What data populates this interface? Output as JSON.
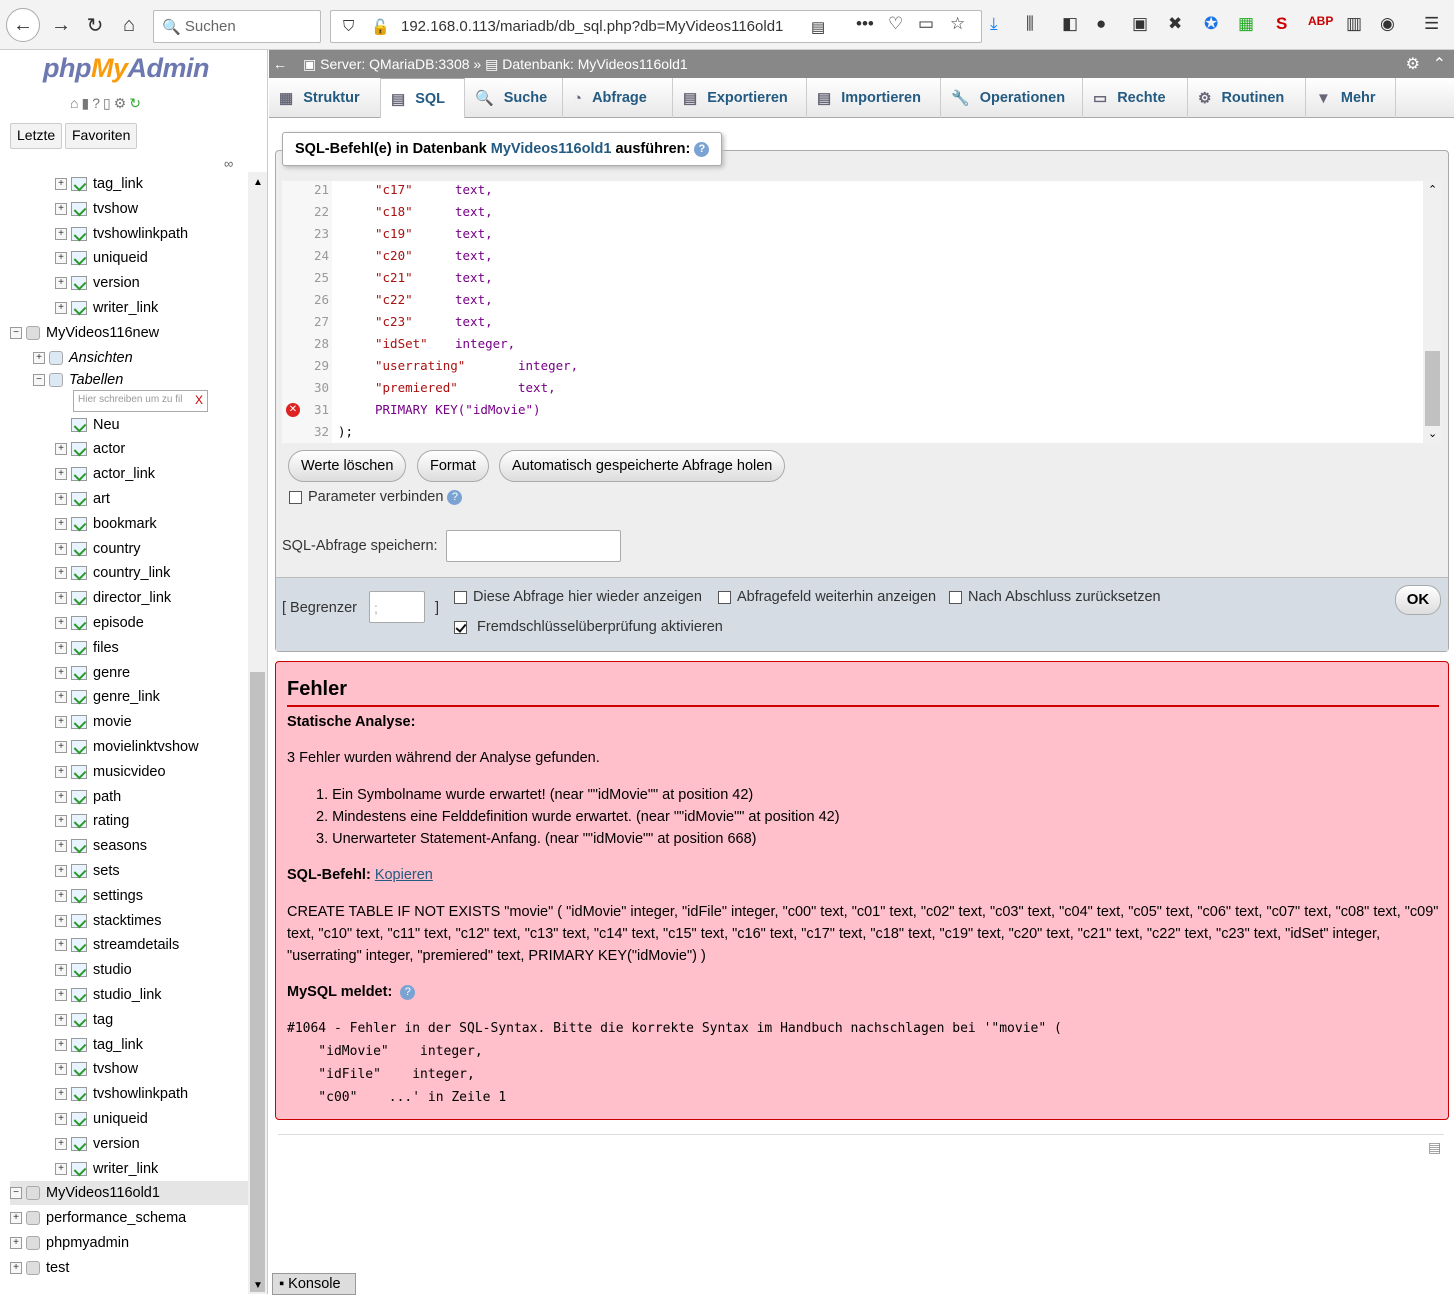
{
  "browser": {
    "search_placeholder": "Suchen",
    "url": "192.168.0.113/mariadb/db_sql.php?db=MyVideos116old1"
  },
  "sidebar": {
    "logo_php": "php",
    "logo_my": "My",
    "logo_admin": "Admin",
    "recent": "Letzte",
    "favorites": "Favoriten",
    "filter_placeholder": "Hier schreiben um zu fil",
    "items": [
      {
        "label": "tag_link",
        "type": "table",
        "indent": 2
      },
      {
        "label": "tvshow",
        "type": "table",
        "indent": 2
      },
      {
        "label": "tvshowlinkpath",
        "type": "table",
        "indent": 2
      },
      {
        "label": "uniqueid",
        "type": "table",
        "indent": 2
      },
      {
        "label": "version",
        "type": "table",
        "indent": 2
      },
      {
        "label": "writer_link",
        "type": "table",
        "indent": 2
      },
      {
        "label": "MyVideos116new",
        "type": "db",
        "indent": 0
      },
      {
        "label": "Ansichten",
        "type": "group",
        "indent": 1
      },
      {
        "label": "Tabellen",
        "type": "group",
        "indent": 1
      },
      {
        "label": "",
        "type": "filter",
        "indent": 2
      },
      {
        "label": "Neu",
        "type": "new",
        "indent": 2
      },
      {
        "label": "actor",
        "type": "table",
        "indent": 2
      },
      {
        "label": "actor_link",
        "type": "table",
        "indent": 2
      },
      {
        "label": "art",
        "type": "table",
        "indent": 2
      },
      {
        "label": "bookmark",
        "type": "table",
        "indent": 2
      },
      {
        "label": "country",
        "type": "table",
        "indent": 2
      },
      {
        "label": "country_link",
        "type": "table",
        "indent": 2
      },
      {
        "label": "director_link",
        "type": "table",
        "indent": 2
      },
      {
        "label": "episode",
        "type": "table",
        "indent": 2
      },
      {
        "label": "files",
        "type": "table",
        "indent": 2
      },
      {
        "label": "genre",
        "type": "table",
        "indent": 2
      },
      {
        "label": "genre_link",
        "type": "table",
        "indent": 2
      },
      {
        "label": "movie",
        "type": "table",
        "indent": 2
      },
      {
        "label": "movielinktvshow",
        "type": "table",
        "indent": 2
      },
      {
        "label": "musicvideo",
        "type": "table",
        "indent": 2
      },
      {
        "label": "path",
        "type": "table",
        "indent": 2
      },
      {
        "label": "rating",
        "type": "table",
        "indent": 2
      },
      {
        "label": "seasons",
        "type": "table",
        "indent": 2
      },
      {
        "label": "sets",
        "type": "table",
        "indent": 2
      },
      {
        "label": "settings",
        "type": "table",
        "indent": 2
      },
      {
        "label": "stacktimes",
        "type": "table",
        "indent": 2
      },
      {
        "label": "streamdetails",
        "type": "table",
        "indent": 2
      },
      {
        "label": "studio",
        "type": "table",
        "indent": 2
      },
      {
        "label": "studio_link",
        "type": "table",
        "indent": 2
      },
      {
        "label": "tag",
        "type": "table",
        "indent": 2
      },
      {
        "label": "tag_link",
        "type": "table",
        "indent": 2
      },
      {
        "label": "tvshow",
        "type": "table",
        "indent": 2
      },
      {
        "label": "tvshowlinkpath",
        "type": "table",
        "indent": 2
      },
      {
        "label": "uniqueid",
        "type": "table",
        "indent": 2
      },
      {
        "label": "version",
        "type": "table",
        "indent": 2
      },
      {
        "label": "writer_link",
        "type": "table",
        "indent": 2
      },
      {
        "label": "MyVideos116old1",
        "type": "db",
        "indent": 0,
        "selected": true
      },
      {
        "label": "performance_schema",
        "type": "db",
        "indent": 0
      },
      {
        "label": "phpmyadmin",
        "type": "db",
        "indent": 0
      },
      {
        "label": "test",
        "type": "db",
        "indent": 0
      }
    ]
  },
  "breadcrumb": {
    "server": "Server: QMariaDB:3308 »",
    "database": "Datenbank: MyVideos116old1"
  },
  "tabs": [
    {
      "label": "Struktur",
      "icon": "structure-icon"
    },
    {
      "label": "SQL",
      "icon": "sql-icon",
      "active": true
    },
    {
      "label": "Suche",
      "icon": "search-icon"
    },
    {
      "label": "Abfrage",
      "icon": "query-icon"
    },
    {
      "label": "Exportieren",
      "icon": "export-icon"
    },
    {
      "label": "Importieren",
      "icon": "import-icon"
    },
    {
      "label": "Operationen",
      "icon": "wrench-icon"
    },
    {
      "label": "Rechte",
      "icon": "privileges-icon"
    },
    {
      "label": "Routinen",
      "icon": "routines-icon"
    },
    {
      "label": "Mehr",
      "icon": "chevron-down-icon"
    }
  ],
  "sql_panel": {
    "legend_prefix": "SQL-Befehl(e) in Datenbank",
    "legend_db": "MyVideos116old1",
    "legend_suffix": "ausführen:",
    "lines": [
      {
        "n": "21",
        "a": "\"c17\"",
        "b": "text,"
      },
      {
        "n": "22",
        "a": "\"c18\"",
        "b": "text,"
      },
      {
        "n": "23",
        "a": "\"c19\"",
        "b": "text,"
      },
      {
        "n": "24",
        "a": "\"c20\"",
        "b": "text,"
      },
      {
        "n": "25",
        "a": "\"c21\"",
        "b": "text,"
      },
      {
        "n": "26",
        "a": "\"c22\"",
        "b": "text,"
      },
      {
        "n": "27",
        "a": "\"c23\"",
        "b": "text,"
      },
      {
        "n": "28",
        "a": "\"idSet\"",
        "b": "integer,"
      },
      {
        "n": "29",
        "a": "\"userrating\"",
        "b": "integer,"
      },
      {
        "n": "30",
        "a": "\"premiered\"",
        "b": "text,"
      },
      {
        "n": "31",
        "a": "PRIMARY KEY(\"idMovie\")",
        "b": "",
        "err": true
      },
      {
        "n": "32",
        "a": ");",
        "b": ""
      }
    ],
    "btn_clear": "Werte löschen",
    "btn_format": "Format",
    "btn_autosaved": "Automatisch gespeicherte Abfrage holen",
    "bind_params": "Parameter verbinden",
    "save_label": "SQL-Abfrage speichern:",
    "delimiter_label": "[ Begrenzer",
    "delimiter_close": "]",
    "delimiter_value": ";",
    "opt_show_again": "Diese Abfrage hier wieder anzeigen",
    "opt_keep_box": "Abfragefeld weiterhin anzeigen",
    "opt_reset": "Nach Abschluss zurücksetzen",
    "opt_fk": "Fremdschlüsselüberprüfung aktivieren",
    "ok": "OK"
  },
  "error": {
    "title": "Fehler",
    "static_analysis": "Statische Analyse:",
    "summary": "3 Fehler wurden während der Analyse gefunden.",
    "list": [
      "1. Ein Symbolname wurde erwartet! (near \"\"idMovie\"\" at position 42)",
      "2. Mindestens eine Felddefinition wurde erwartet. (near \"\"idMovie\"\" at position 42)",
      "3. Unerwarteter Statement-Anfang. (near \"\"idMovie\"\" at position 668)"
    ],
    "sql_label": "SQL-Befehl:",
    "copy": "Kopieren",
    "sql_lines": [
      "CREATE TABLE IF NOT EXISTS \"movie\" ( \"idMovie\" integer, \"idFile\" integer, \"c00\" text, \"c01\" text, \"c02\" text, \"c03\" text, \"c04\" text, \"c05\" text, \"c06\" text, \"c07\" text, \"c08\" text, \"c09\"",
      "text, \"c10\" text, \"c11\" text, \"c12\" text, \"c13\" text, \"c14\" text, \"c15\" text, \"c16\" text, \"c17\" text, \"c18\" text, \"c19\" text, \"c20\" text, \"c21\" text, \"c22\" text, \"c23\" text, \"idSet\" integer,",
      "\"userrating\" integer, \"premiered\" text, PRIMARY KEY(\"idMovie\") )"
    ],
    "mysql_label": "MySQL meldet:",
    "mysql_msg": "#1064 - Fehler in der SQL-Syntax. Bitte die korrekte Syntax im Handbuch nachschlagen bei '\"movie\" (\n    \"idMovie\"    integer,\n    \"idFile\"    integer,\n    \"c00\"    ...' in Zeile 1"
  },
  "console": "Konsole"
}
